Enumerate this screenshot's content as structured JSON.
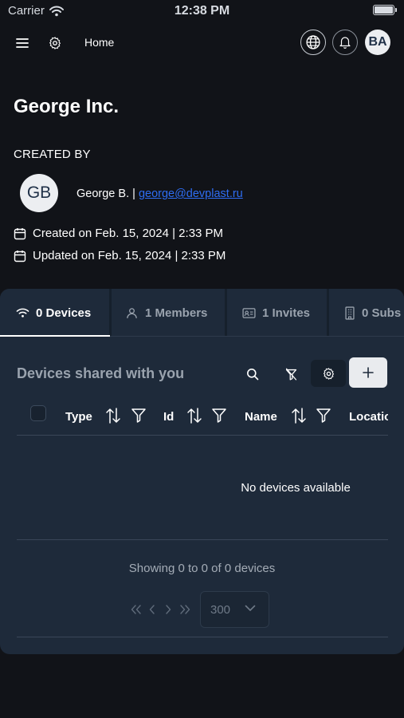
{
  "status_bar": {
    "carrier": "Carrier",
    "time": "12:38 PM"
  },
  "nav": {
    "home_label": "Home",
    "user_initials": "BA"
  },
  "organization": {
    "name": "George Inc.",
    "created_by_label": "CREATED BY",
    "creator_initials": "GB",
    "creator_name": "George B.",
    "separator": "|",
    "creator_email": "george@devplast.ru",
    "created_label": "Created on Feb. 15, 2024 | 2:33 PM",
    "updated_label": "Updated on Feb. 15, 2024 | 2:33 PM"
  },
  "tabs": [
    {
      "label": "0 Devices",
      "icon": "wifi-icon",
      "active": true
    },
    {
      "label": "1 Members",
      "icon": "user-icon",
      "active": false
    },
    {
      "label": "1 Invites",
      "icon": "id-card-icon",
      "active": false
    },
    {
      "label": "0 Subs",
      "icon": "building-icon",
      "active": false
    }
  ],
  "devices": {
    "title": "Devices shared with you",
    "columns": [
      "Type",
      "Id",
      "Name",
      "Locatio"
    ],
    "empty_message": "No devices available",
    "showing_text": "Showing 0 to 0 of 0 devices",
    "page_size": "300"
  },
  "colors": {
    "background": "#111318",
    "panel": "#1e2a3a",
    "link": "#2e6df2",
    "muted_text": "#9aa3ae"
  }
}
